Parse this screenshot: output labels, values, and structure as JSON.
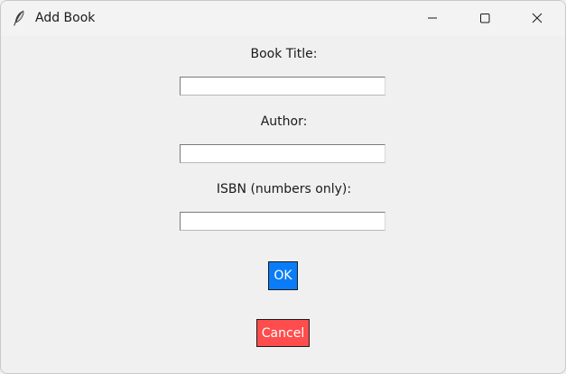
{
  "window": {
    "title": "Add Book",
    "app_icon": "feather-icon"
  },
  "window_controls": {
    "minimize_icon": "minimize-icon",
    "maximize_icon": "maximize-icon",
    "close_icon": "close-icon"
  },
  "form": {
    "title_label": "Book Title:",
    "title_value": "",
    "author_label": "Author:",
    "author_value": "",
    "isbn_label": "ISBN (numbers only):",
    "isbn_value": ""
  },
  "buttons": {
    "ok_label": "OK",
    "ok_color": "#0a7cf8",
    "cancel_label": "Cancel",
    "cancel_color": "#ff4c4c"
  }
}
